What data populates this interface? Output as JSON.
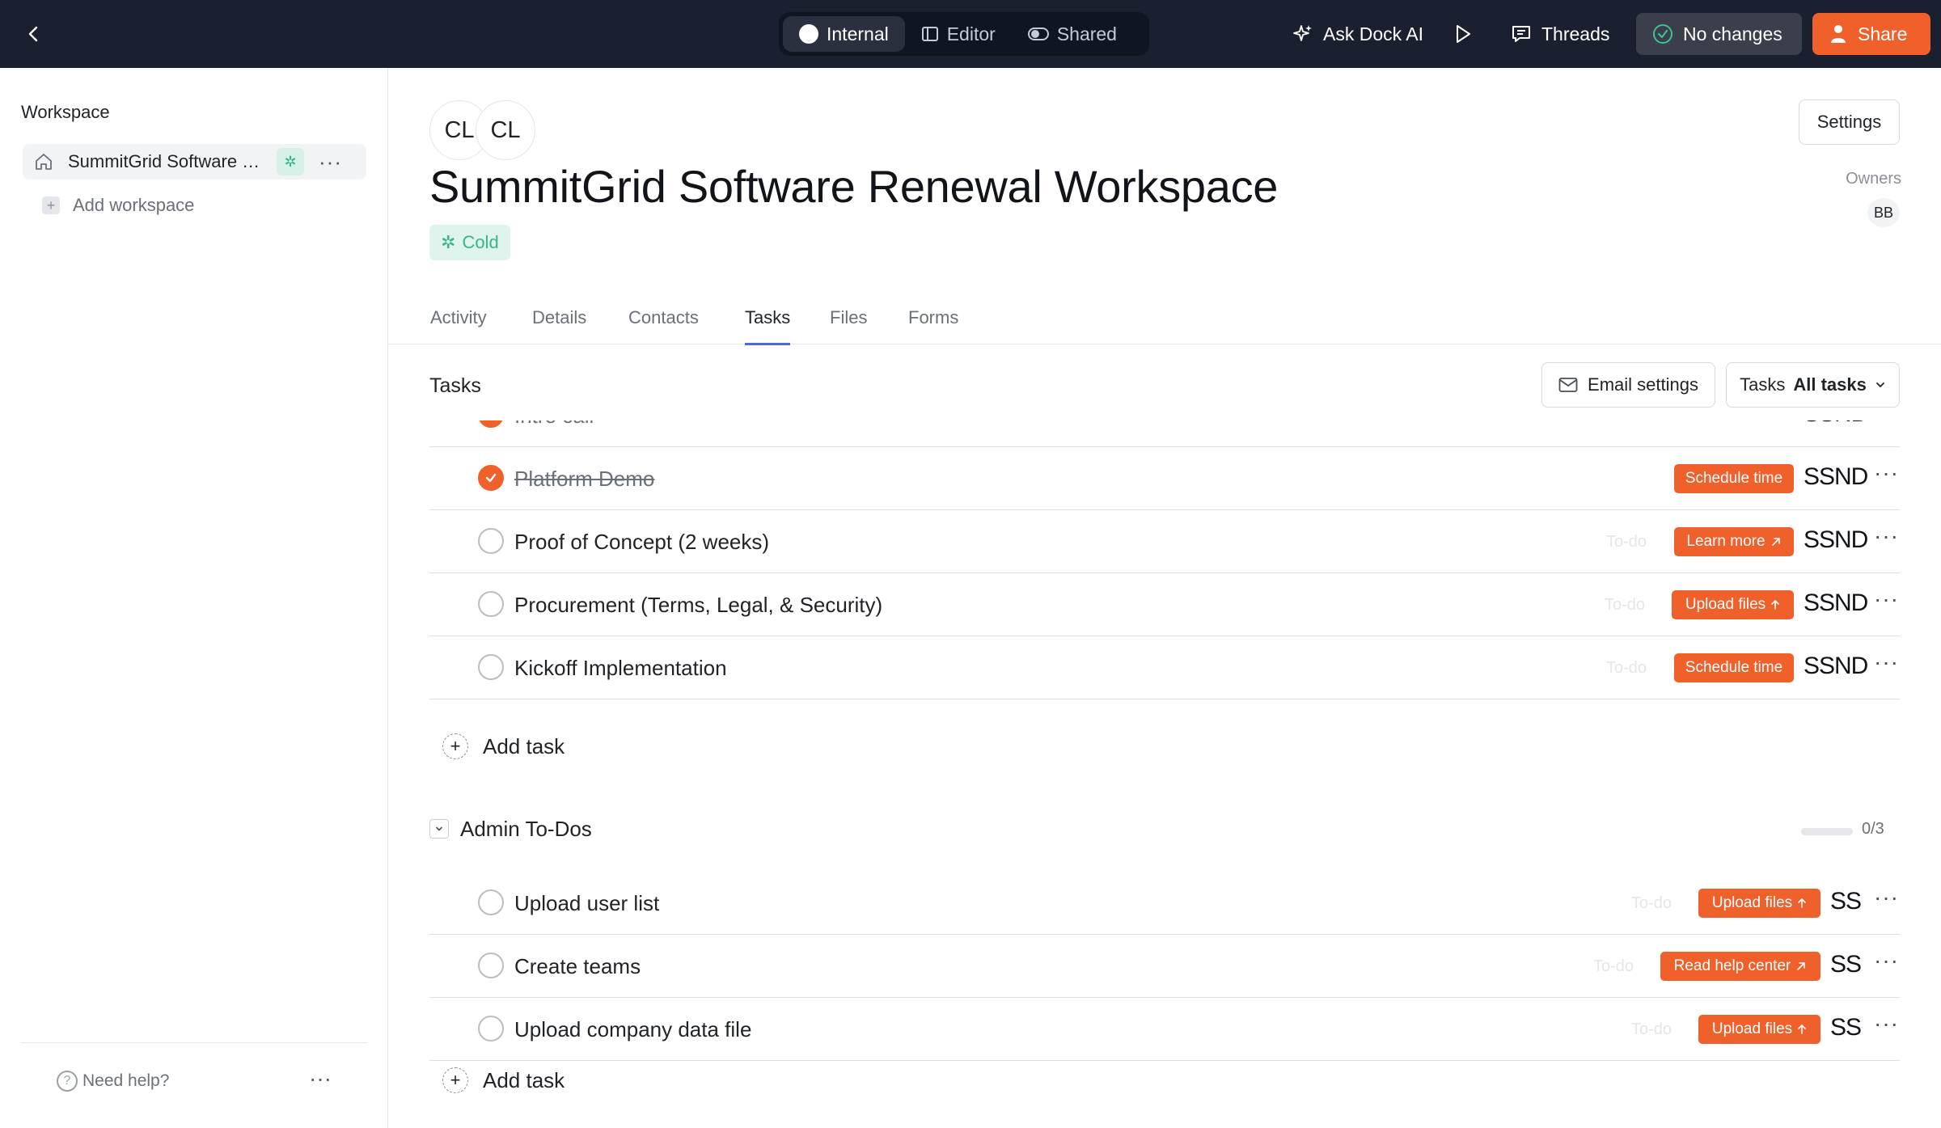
{
  "topbar": {
    "modes": [
      {
        "label": "Internal",
        "active": true
      },
      {
        "label": "Editor",
        "active": false
      },
      {
        "label": "Shared",
        "active": false
      }
    ],
    "ask_ai": "Ask Dock AI",
    "threads": "Threads",
    "status": "No changes",
    "share": "Share"
  },
  "sidebar": {
    "title": "Workspace",
    "workspace_name": "SummitGrid Software Renewal Workspace",
    "add_workspace": "Add workspace",
    "help": "Need help?"
  },
  "header": {
    "avatars": [
      "CL",
      "CL"
    ],
    "title": "SummitGrid Software Renewal Workspace",
    "status_tag": "Cold",
    "settings": "Settings",
    "owners_label": "Owners",
    "owner_initials": "BB"
  },
  "tabs": [
    {
      "label": "Activity",
      "active": false
    },
    {
      "label": "Details",
      "active": false
    },
    {
      "label": "Contacts",
      "active": false
    },
    {
      "label": "Tasks",
      "active": true
    },
    {
      "label": "Files",
      "active": false
    },
    {
      "label": "Forms",
      "active": false
    }
  ],
  "tasks_section": {
    "title": "Tasks",
    "email_settings": "Email settings",
    "filter_prefix": "Tasks",
    "filter_value": "All tasks"
  },
  "group1": {
    "tasks": [
      {
        "title": "Intro call",
        "done": true,
        "status": "",
        "action": "",
        "action_icon": "",
        "assignee": "SSND"
      },
      {
        "title": "Platform Demo",
        "done": true,
        "status": "",
        "action": "Schedule time",
        "action_icon": "",
        "assignee": "SSND"
      },
      {
        "title": "Proof of Concept (2 weeks)",
        "done": false,
        "status": "To-do",
        "action": "Learn more",
        "action_icon": "arrow-up-right-icon",
        "assignee": "SSND"
      },
      {
        "title": "Procurement (Terms, Legal, & Security)",
        "done": false,
        "status": "To-do",
        "action": "Upload files",
        "action_icon": "arrow-up-icon",
        "assignee": "SSND"
      },
      {
        "title": "Kickoff Implementation",
        "done": false,
        "status": "To-do",
        "action": "Schedule time",
        "action_icon": "",
        "assignee": "SSND"
      }
    ],
    "add_task": "Add task"
  },
  "group2": {
    "title": "Admin To-Dos",
    "progress_done": 0,
    "progress_total": 3,
    "progress_text": "0/3",
    "tasks": [
      {
        "title": "Upload user list",
        "done": false,
        "status": "To-do",
        "action": "Upload files",
        "action_icon": "arrow-up-icon",
        "assignee": "SS"
      },
      {
        "title": "Create teams",
        "done": false,
        "status": "To-do",
        "action": "Read help center",
        "action_icon": "arrow-up-right-icon",
        "assignee": "SS"
      },
      {
        "title": "Upload company data file",
        "done": false,
        "status": "To-do",
        "action": "Upload files",
        "action_icon": "arrow-up-icon",
        "assignee": "SS"
      }
    ],
    "add_task": "Add task"
  },
  "colors": {
    "accent": "#f0602a",
    "topbar_bg": "#1b2030",
    "tab_underline": "#4c67e6",
    "status_tag": "#35b58c"
  }
}
